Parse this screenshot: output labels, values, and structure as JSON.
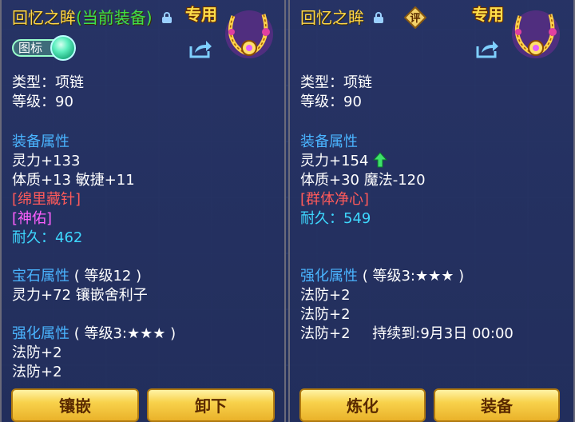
{
  "left": {
    "title_prefix": "回忆之眸",
    "title_equipped": "(当前装备)",
    "exclusive": "专用",
    "toggle_label": "图标",
    "type": "类型：项链",
    "level": "等级：90",
    "equip_attr_header": "装备属性",
    "stat_lingli": "灵力+133",
    "stat_tizhi": "体质+13 敏捷+11",
    "tag1": "[绵里藏针]",
    "tag2": "[神佑]",
    "durability_label": "耐久：",
    "durability_value": "462",
    "gem_header": "宝石属性",
    "gem_level": "( 等级12 )",
    "gem_line": "灵力+72 镶嵌舍利子",
    "enh_header": "强化属性",
    "enh_level": "( 等级3:★★★ )",
    "enh1": "法防+2",
    "enh2": "法防+2",
    "btn_inlay": "镶嵌",
    "btn_unequip": "卸下"
  },
  "right": {
    "title": "回忆之眸",
    "ping_label": "评",
    "exclusive": "专用",
    "type": "类型：项链",
    "level": "等级：90",
    "equip_attr_header": "装备属性",
    "stat_lingli": "灵力+154",
    "stat_tizhi": "体质+30 魔法-120",
    "tag1": "[群体净心]",
    "durability_label": "耐久：",
    "durability_value": "549",
    "enh_header": "强化属性",
    "enh_level": "( 等级3:★★★ )",
    "enh1": "法防+2",
    "enh2": "法防+2",
    "enh3": "法防+2",
    "duration": "持续到:9月3日 00:00",
    "btn_refine": "炼化",
    "btn_equip": "装备"
  },
  "colors": {
    "title": "#ffd84a",
    "equipped": "#3fe04a",
    "header": "#4ab4ff",
    "special_red": "#ff5a5a",
    "special_magenta": "#ff60ff",
    "durability": "#3ed8ff",
    "button": "#f8d24c"
  },
  "icons": {
    "lock": "lock-icon",
    "share": "share-icon",
    "necklace": "necklace-icon",
    "upgrade": "up-arrow-icon"
  }
}
